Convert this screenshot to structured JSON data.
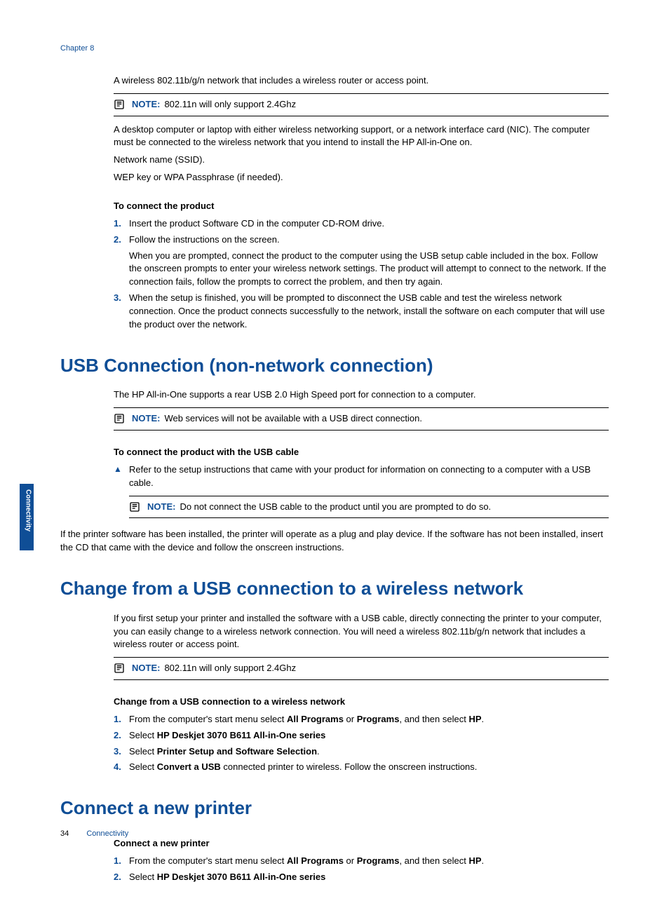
{
  "sidebarTab": "Connectivity",
  "chapterLabel": "Chapter 8",
  "intro": {
    "p1": "A wireless 802.11b/g/n network that includes a wireless router or access point.",
    "note1": "802.11n will only support 2.4Ghz",
    "p2": "A desktop computer or laptop with either wireless networking support, or a network interface card (NIC). The computer must be connected to the wireless network that you intend to install the HP All-in-One on.",
    "p3": "Network name (SSID).",
    "p4": "WEP key or WPA Passphrase (if needed)."
  },
  "noteLabel": "NOTE:",
  "connect": {
    "heading": "To connect the product",
    "s1": "Insert the product Software CD in the computer CD-ROM drive.",
    "s2a": "Follow the instructions on the screen.",
    "s2b": "When you are prompted, connect the product to the computer using the USB setup cable included in the box. Follow the onscreen prompts to enter your wireless network settings. The product will attempt to connect to the network. If the connection fails, follow the prompts to correct the problem, and then try again.",
    "s3": "When the setup is finished, you will be prompted to disconnect the USB cable and test the wireless network connection. Once the product connects successfully to the network, install the software on each computer that will use the product over the network."
  },
  "usb": {
    "title": "USB Connection (non-network connection)",
    "p1": "The HP All-in-One supports a rear USB 2.0 High Speed port for connection to a computer.",
    "note1": "Web services will not be available with a USB direct connection.",
    "heading": "To connect the product with the USB cable",
    "s1": "Refer to the setup instructions that came with your product for information on connecting to a computer with a USB cable.",
    "note2": "Do not connect the USB cable to the product until you are prompted to do so.",
    "p2": "If the printer software has been installed, the printer will operate as a plug and play device. If the software has not been installed, insert the CD that came with the device and follow the onscreen instructions."
  },
  "change": {
    "title": "Change from a USB connection to a wireless network",
    "p1": "If you first setup your printer and installed the software with a USB cable, directly connecting the printer to your computer, you can easily change to a wireless network connection. You will need a wireless 802.11b/g/n network that includes a wireless router or access point.",
    "note1": "802.11n will only support 2.4Ghz",
    "heading": "Change from a USB connection to a wireless network",
    "s1a": "From the computer's start menu select ",
    "s1b": "All Programs",
    "s1c": " or ",
    "s1d": "Programs",
    "s1e": ", and then select ",
    "s1f": "HP",
    "s1g": ".",
    "s2a": "Select ",
    "s2b": "HP Deskjet 3070 B611 All-in-One series",
    "s3a": "Select ",
    "s3b": "Printer Setup and Software Selection",
    "s3c": ".",
    "s4a": "Select ",
    "s4b": "Convert a USB",
    "s4c": " connected printer to wireless. Follow the onscreen instructions."
  },
  "newPrinter": {
    "title": "Connect a new printer",
    "heading": "Connect a new printer",
    "s1a": "From the computer's start menu select ",
    "s1b": "All Programs",
    "s1c": " or ",
    "s1d": "Programs",
    "s1e": ", and then select ",
    "s1f": "HP",
    "s1g": ".",
    "s2a": "Select ",
    "s2b": "HP Deskjet 3070 B611 All-in-One series"
  },
  "footer": {
    "pageNum": "34",
    "section": "Connectivity"
  }
}
